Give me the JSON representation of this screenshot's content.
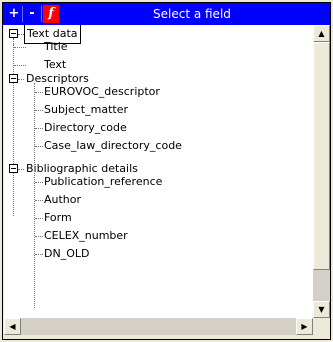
{
  "toolbar": {
    "add_label": "+",
    "remove_label": "-",
    "function_label": "f",
    "title": "Select a field"
  },
  "tree": {
    "groups": [
      {
        "label": "Text data",
        "children": [
          "Title",
          "Text"
        ]
      },
      {
        "label": "Descriptors",
        "children": [
          "EUROVOC_descriptor",
          "Subject_matter",
          "Directory_code",
          "Case_law_directory_code"
        ]
      },
      {
        "label": "Bibliographic details",
        "children": [
          "Publication_reference",
          "Author",
          "Form",
          "CELEX_number",
          "DN_OLD"
        ]
      }
    ]
  },
  "scrollbars": {
    "up": "▲",
    "down": "▼",
    "left": "◀",
    "right": "▶"
  }
}
